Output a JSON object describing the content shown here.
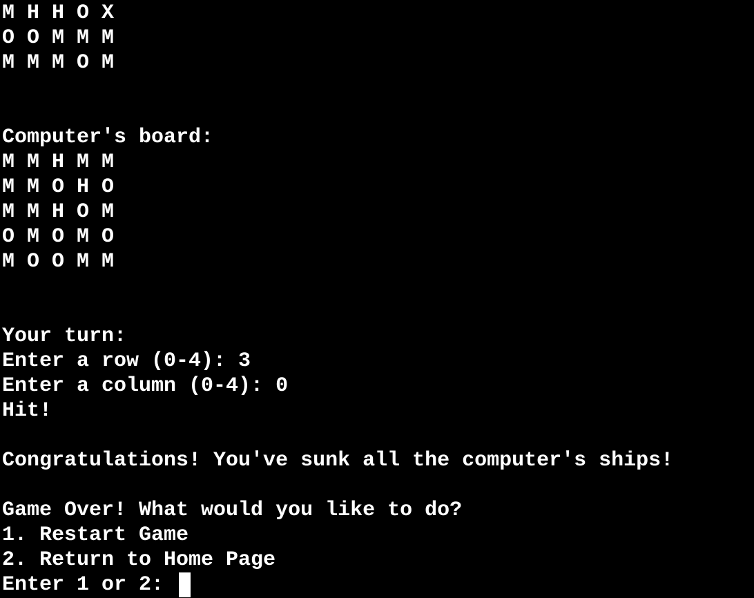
{
  "player_board": {
    "rows": [
      "M H H O X",
      "O O M M M",
      "M M M O M"
    ]
  },
  "computer_board": {
    "title": "Computer's board:",
    "rows": [
      "M M H M M",
      "M M O H O",
      "M M H O M",
      "O M O M O",
      "M O O M M"
    ]
  },
  "turn": {
    "heading": "Your turn:",
    "row_prompt": "Enter a row (0-4): 3",
    "column_prompt": "Enter a column (0-4): 0",
    "result": "Hit!"
  },
  "congrats": "Congratulations! You've sunk all the computer's ships!",
  "game_over": {
    "question": "Game Over! What would you like to do?",
    "options": [
      "1. Restart Game",
      "2. Return to Home Page"
    ],
    "prompt": "Enter 1 or 2: "
  },
  "colors": {
    "background": "#000000",
    "text": "#ffffff"
  }
}
